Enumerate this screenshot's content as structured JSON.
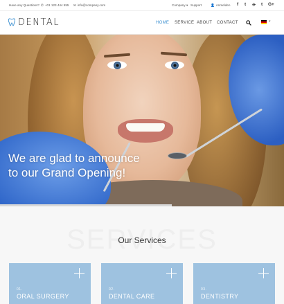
{
  "topbar": {
    "question": "Have any Questions?",
    "phone": "+01 123 444 555",
    "email": "info@company.com",
    "company": "Company",
    "support": "Support",
    "login": "Anmelden",
    "social": [
      "f",
      "t",
      "✈",
      "t",
      "G+"
    ]
  },
  "header": {
    "logo": "DENTAL",
    "nav": [
      "HOME",
      "SERVICE",
      "ABOUT",
      "CONTACT"
    ],
    "active": "HOME",
    "language_flag": "de-flag"
  },
  "hero": {
    "line1": "We are glad to announce",
    "line2": "to our Grand Opening!"
  },
  "services": {
    "background_word": "SERVICES",
    "title": "Our Services",
    "items": [
      {
        "num": "01.",
        "name": "ORAL SURGERY"
      },
      {
        "num": "02.",
        "name": "DENTAL CARE"
      },
      {
        "num": "03.",
        "name": "DENTISTRY"
      }
    ]
  },
  "colors": {
    "accent": "#3b8fd0",
    "card": "#9ec2e0"
  }
}
